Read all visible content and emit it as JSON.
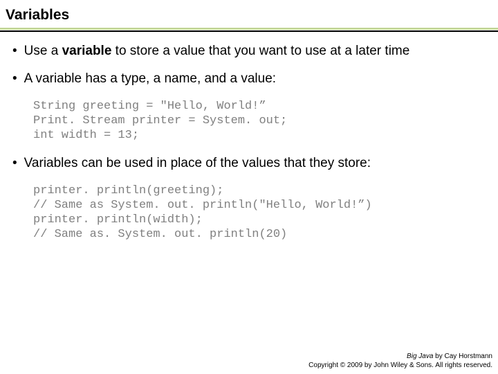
{
  "title": "Variables",
  "bullets": {
    "b1_pre": "Use a ",
    "b1_bold": "variable",
    "b1_post": " to store a value that you want to use at a later time",
    "b2": "A variable has a type, a name, and a value:",
    "b3": "Variables can be used in place of the values that they store:"
  },
  "code": {
    "block1": "String greeting = \"Hello, World!”\nPrint. Stream printer = System. out;\nint width = 13;",
    "block2": "printer. println(greeting);\n// Same as System. out. println(\"Hello, World!”)\nprinter. println(width);\n// Same as. System. out. println(20)"
  },
  "footer": {
    "book": "Big Java",
    "author": " by Cay Horstmann",
    "copyright": "Copyright © 2009 by John Wiley & Sons. All rights reserved."
  }
}
